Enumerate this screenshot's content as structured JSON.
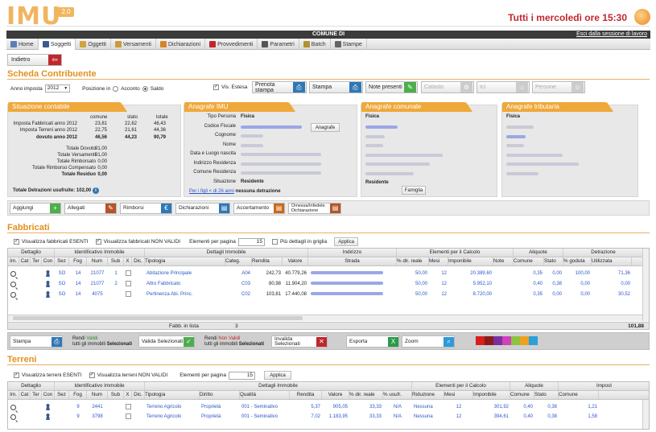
{
  "header": {
    "logo_text": "IMU",
    "logo_badge": "2.0",
    "tagline": "Tutti i mercoledì ore 15:30"
  },
  "comune_bar": {
    "title": "COMUNE DI",
    "exit_link": "Esci dalla sessione di lavoro"
  },
  "nav": {
    "tabs": [
      {
        "label": "Home",
        "icon": "home-icon",
        "color": "#5a7fb5"
      },
      {
        "label": "Soggetti",
        "icon": "person-icon",
        "color": "#3b5a8c"
      },
      {
        "label": "Oggetti",
        "icon": "building-icon",
        "color": "#d4a33a"
      },
      {
        "label": "Versamenti",
        "icon": "money-icon",
        "color": "#c89b3c"
      },
      {
        "label": "Dichiarazioni",
        "icon": "mail-icon",
        "color": "#d7832a"
      },
      {
        "label": "Provvedimenti",
        "icon": "exclamation-icon",
        "color": "#c0272d"
      },
      {
        "label": "Parametri",
        "icon": "calculator-icon",
        "color": "#555"
      },
      {
        "label": "Batch",
        "icon": "gear-icon",
        "color": "#b3922e"
      },
      {
        "label": "Stampe",
        "icon": "printer-icon",
        "color": "#666"
      }
    ],
    "active": 1
  },
  "back_button": {
    "label": "Indietro",
    "icon": "back-arrow-icon"
  },
  "scheda": {
    "title": "Scheda Contribuente",
    "anno_label": "Anno imposta",
    "anno_value": "2012",
    "posizione_label": "Posizione in",
    "radio_acconto": "Acconto",
    "radio_saldo": "Saldo",
    "vis_estesa_label": "Vis. Estesa",
    "btn_prenota": "Prenota stampa",
    "btn_stampa": "Stampa",
    "btn_note": "Note presenti",
    "btn_catasto": "Catasto",
    "btn_ici": "Ici",
    "btn_persone": "Persone"
  },
  "situazione": {
    "title": "Situazione contabile",
    "cols": [
      "comune",
      "stato",
      "totale"
    ],
    "rows": [
      {
        "label": "Imposta Fabbricati anno 2012",
        "v": [
          "23,81",
          "22,62",
          "46,43"
        ]
      },
      {
        "label": "Imposta Terreni anno 2012",
        "v": [
          "22,75",
          "21,61",
          "44,36"
        ]
      },
      {
        "label": "dovuto anno 2012",
        "v": [
          "46,56",
          "44,23",
          "90,79"
        ]
      }
    ],
    "totals": [
      {
        "label": "Totale Dovuto",
        "v": "91,00"
      },
      {
        "label": "Totale Versamenti",
        "v": "91,00"
      },
      {
        "label": "Totale Rimborsato",
        "v": "0,00"
      },
      {
        "label": "Totale Rimborso Compensato",
        "v": "0,00"
      },
      {
        "label": "Totale Residuo",
        "v": "0,00"
      }
    ],
    "detrazioni_label": "Totale Detrazioni usufruite:",
    "detrazioni_value": "102,00"
  },
  "anagrafe_imu": {
    "title": "Anagrafe IMU",
    "labels": [
      "Tipo Persona",
      "Codice Fiscale",
      "Cognome",
      "Nome",
      "Data e Luogo nascita",
      "Indirizzo Residenza",
      "Comune Residenza",
      "Situazione"
    ],
    "tipo_persona": "Fisica",
    "situazione": "Residente",
    "btn_anagrafe": "Anagrafe",
    "figli_link": "Per i figli < di 26 anni",
    "figli_value": "nessuna detrazione"
  },
  "anagrafe_comunale": {
    "title": "Anagrafe comunale",
    "tipo": "Fisica",
    "situazione": "Residente",
    "btn_famiglia": "Famiglia"
  },
  "anagrafe_tributaria": {
    "title": "Anagrafe tributaria",
    "tipo": "Fisica"
  },
  "action_bar": [
    {
      "label": "Aggiungi",
      "icon": "plus-icon",
      "color": "#4cae4c"
    },
    {
      "label": "Allegati",
      "icon": "paperclip-icon",
      "color": "#b5542a"
    },
    {
      "label": "Rimborsi",
      "icon": "euro-icon",
      "color": "#2f78b5"
    },
    {
      "label": "Dichiarazioni",
      "icon": "document-icon",
      "color": "#2f78b5"
    },
    {
      "label": "Accertamento",
      "icon": "document-icon",
      "color": "#c86a1a"
    },
    {
      "label": "Omessa/Infedele Dichiarazione",
      "icon": "document-icon",
      "color": "#b5542a"
    }
  ],
  "fabbricati": {
    "title": "Fabbricati",
    "chk_esenti": "Visualizza fabbricati ESENTI",
    "chk_non_validi": "Visualizza fabbricati NON VALIDI",
    "per_pagina_label": "Elementi per pagina",
    "per_pagina_value": "15",
    "chk_dettagli": "Più dettagli in griglia",
    "btn_applica": "Applica",
    "groups": [
      "Dettaglio",
      "Identificativo Immobile",
      "Dettagli Immobile",
      "Indirizzo",
      "Elementi per il Calcolo",
      "Aliquote",
      "Detrazione"
    ],
    "cols": [
      "Im.",
      "Cat",
      "Ter",
      "Con",
      "Sez",
      "Fog",
      "Num",
      "Sub",
      "X",
      "Dic.",
      "Tipologia",
      "Categ.",
      "Rendita",
      "Valore",
      "Strada",
      "% dir. reale",
      "Mesi",
      "Imponibile",
      "Note",
      "Comune",
      "Stato",
      "% goduta",
      "Utilizzata"
    ],
    "rows": [
      {
        "sez": "SO",
        "fog": "14",
        "num": "21077",
        "sub": "1",
        "tipologia": "Abitazione Principale",
        "categ": "A04",
        "rendita": "242,73",
        "valore": "40.779,26",
        "dir": "50,00",
        "mesi": "12",
        "imponibile": "20.389,60",
        "comune": "0,35",
        "stato": "0,00",
        "goduta": "100,00",
        "utilizzata": "71,36"
      },
      {
        "sez": "SO",
        "fog": "14",
        "num": "21077",
        "sub": "2",
        "tipologia": "Altro Fabbricato",
        "categ": "C03",
        "rendita": "80,98",
        "valore": "11.904,20",
        "dir": "50,00",
        "mesi": "12",
        "imponibile": "5.952,10",
        "comune": "0,40",
        "stato": "0,38",
        "goduta": "0,00",
        "utilizzata": "0,00"
      },
      {
        "sez": "SO",
        "fog": "14",
        "num": "4075",
        "sub": "",
        "tipologia": "Pertinenza Abi. Princ.",
        "categ": "C02",
        "rendita": "103,81",
        "valore": "17.440,08",
        "dir": "50,00",
        "mesi": "12",
        "imponibile": "8.720,00",
        "comune": "0,35",
        "stato": "0,00",
        "goduta": "0,00",
        "utilizzata": "30,52"
      }
    ],
    "fabb_in_lista_label": "Fabb. in lista",
    "fabb_in_lista_value": "3",
    "total_detrazione": "101,88"
  },
  "bottom_bar": {
    "stampa": "Stampa",
    "rendi_validi_1": "Rendi",
    "rendi_validi_2": "Validi",
    "rendi_validi_3": "tutti gli immobili",
    "rendi_validi_4": "Selezionati",
    "valida": "Valida Selezionati",
    "rendi_non_validi_1": "Rendi",
    "rendi_non_validi_2": "Non Validi",
    "rendi_non_validi_3": "tutti gli immobili",
    "rendi_non_validi_4": "Selezionati",
    "invalida": "Invalida Selezionati",
    "esporta": "Esporta",
    "zoom": "Zoom",
    "swatches": [
      "#d81e1e",
      "#8b1a1a",
      "#7a2fa0",
      "#d040b8",
      "#8bc53f",
      "#f0a020",
      "#2aa0d8"
    ]
  },
  "terreni": {
    "title": "Terreni",
    "chk_esenti": "Visualizza terreni ESENTI",
    "chk_non_validi": "Visualizza terreni NON VALIDI",
    "per_pagina_label": "Elementi per pagina",
    "per_pagina_value": "15",
    "btn_applica": "Applica",
    "groups": [
      "Dettaglio",
      "Identificativo Immobile",
      "Dettagli Immobile",
      "Elementi per il Calcolo",
      "Aliquote",
      "Impost"
    ],
    "cols": [
      "Im.",
      "Cat",
      "Ter",
      "Con",
      "Sez",
      "Fog",
      "Num",
      "Sub",
      "X",
      "Dic.",
      "Tipologia",
      "Diritto",
      "Qualità",
      "Rendita",
      "Valore",
      "% dir. reale",
      "% usufr.",
      "Riduzione",
      "Mesi",
      "Imponibile",
      "Comune",
      "Stato",
      "Comune"
    ],
    "rows": [
      {
        "fog": "9",
        "num": "2441",
        "tipologia": "Terreno Agricolo",
        "diritto": "Proprietà",
        "qualita": "001 - Seminativo",
        "rendita": "5,37",
        "valore": "905,05",
        "dir": "33,33",
        "usufr": "N/A",
        "riduzione": "Nessuna",
        "mesi": "12",
        "imponibile": "301,92",
        "comune": "0,40",
        "stato": "0,38",
        "imp": "1,21"
      },
      {
        "fog": "9",
        "num": "3798",
        "tipologia": "Terreno Agricolo",
        "diritto": "Proprietà",
        "qualita": "001 - Seminativo",
        "rendita": "7,02",
        "valore": "1.183,95",
        "dir": "33,33",
        "usufr": "N/A",
        "riduzione": "Nessuna",
        "mesi": "12",
        "imponibile": "394,61",
        "comune": "0,40",
        "stato": "0,38",
        "imp": "1,58"
      }
    ]
  }
}
